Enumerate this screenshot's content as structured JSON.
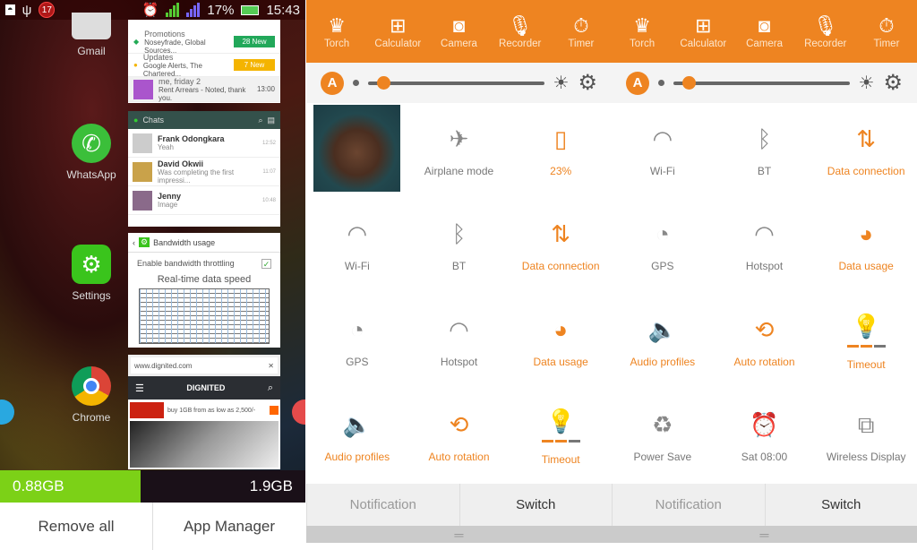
{
  "left": {
    "status": {
      "badge": "17",
      "battery": "17%",
      "time": "15:43"
    },
    "apps": [
      {
        "label": "Gmail"
      },
      {
        "label": "WhatsApp"
      },
      {
        "label": "Settings"
      },
      {
        "label": "Chrome"
      }
    ],
    "gmail": {
      "rows": [
        {
          "title": "Promotions",
          "sub": "Noseyfrade, Global Sources...",
          "pill": "28 New",
          "color": "#22a85a"
        },
        {
          "title": "Updates",
          "sub": "Google Alerts, The Chartered...",
          "pill": "7 New",
          "color": "#f4b400"
        }
      ],
      "mail": {
        "from": "me, friday  2",
        "snippet": "Rent Arrears - Noted, thank you.",
        "time": "13:00"
      }
    },
    "whatsapp": {
      "title": "Chats",
      "chats": [
        {
          "name": "Frank Odongkara",
          "msg": "Yeah",
          "time": "12:52"
        },
        {
          "name": "David Okwii",
          "msg": "Was completing the first impressi...",
          "time": "11:07"
        },
        {
          "name": "Jenny",
          "msg": "Image",
          "time": "10:48"
        }
      ]
    },
    "bandwidth": {
      "title": "Bandwidth usage",
      "option": "Enable bandwidth throttling",
      "checked": true,
      "chart_title": "Real-time data speed"
    },
    "chrome": {
      "url": "www.dignited.com",
      "site": "DIGNITED",
      "ad": "buy 1GB from as low as 2,500/-"
    },
    "memory": {
      "used": "0.88GB",
      "total": "1.9GB",
      "used_fraction": 0.46
    },
    "buttons": {
      "remove_all": "Remove all",
      "app_manager": "App Manager"
    }
  },
  "right": {
    "accent": "#ee8421",
    "tools": [
      {
        "label": "Torch",
        "icon": "torch-icon"
      },
      {
        "label": "Calculator",
        "icon": "calculator-icon"
      },
      {
        "label": "Camera",
        "icon": "camera-icon"
      },
      {
        "label": "Recorder",
        "icon": "microphone-icon"
      },
      {
        "label": "Timer",
        "icon": "stopwatch-icon"
      }
    ],
    "brightness": {
      "auto": "A",
      "level": 0.05
    },
    "tiles": [
      {
        "label": "",
        "icon": "photo",
        "state": "photo"
      },
      {
        "label": "Airplane mode",
        "icon": "airplane-icon",
        "state": "off"
      },
      {
        "label": "23%",
        "icon": "battery-icon",
        "state": "on"
      },
      {
        "label": "Wi-Fi",
        "icon": "wifi-icon",
        "state": "off"
      },
      {
        "label": "BT",
        "icon": "bluetooth-icon",
        "state": "off"
      },
      {
        "label": "Data connection",
        "icon": "data-connection-icon",
        "state": "on"
      },
      {
        "label": "Wi-Fi",
        "icon": "wifi-icon",
        "state": "off"
      },
      {
        "label": "BT",
        "icon": "bluetooth-icon",
        "state": "off"
      },
      {
        "label": "Data connection",
        "icon": "data-connection-icon",
        "state": "on"
      },
      {
        "label": "GPS",
        "icon": "gps-icon",
        "state": "off"
      },
      {
        "label": "Hotspot",
        "icon": "hotspot-icon",
        "state": "off"
      },
      {
        "label": "Data usage",
        "icon": "data-usage-icon",
        "state": "on"
      },
      {
        "label": "GPS",
        "icon": "gps-icon",
        "state": "off"
      },
      {
        "label": "Hotspot",
        "icon": "hotspot-icon",
        "state": "off"
      },
      {
        "label": "Data usage",
        "icon": "data-usage-icon",
        "state": "on"
      },
      {
        "label": "Audio profiles",
        "icon": "audio-profiles-icon",
        "state": "on"
      },
      {
        "label": "Auto rotation",
        "icon": "auto-rotation-icon",
        "state": "on"
      },
      {
        "label": "Timeout",
        "icon": "timeout-icon",
        "state": "on"
      },
      {
        "label": "Audio profiles",
        "icon": "audio-profiles-icon",
        "state": "on"
      },
      {
        "label": "Auto rotation",
        "icon": "auto-rotation-icon",
        "state": "on"
      },
      {
        "label": "Timeout",
        "icon": "timeout-icon",
        "state": "on"
      },
      {
        "label": "Power Save",
        "icon": "power-save-icon",
        "state": "off"
      },
      {
        "label": "Sat 08:00",
        "icon": "alarm-icon",
        "state": "blue"
      },
      {
        "label": "Wireless Display",
        "icon": "wireless-display-icon",
        "state": "off"
      }
    ],
    "tabs": [
      {
        "label": "Notification",
        "active": false
      },
      {
        "label": "Switch",
        "active": true
      },
      {
        "label": "Notification",
        "active": false
      },
      {
        "label": "Switch",
        "active": true
      }
    ]
  }
}
